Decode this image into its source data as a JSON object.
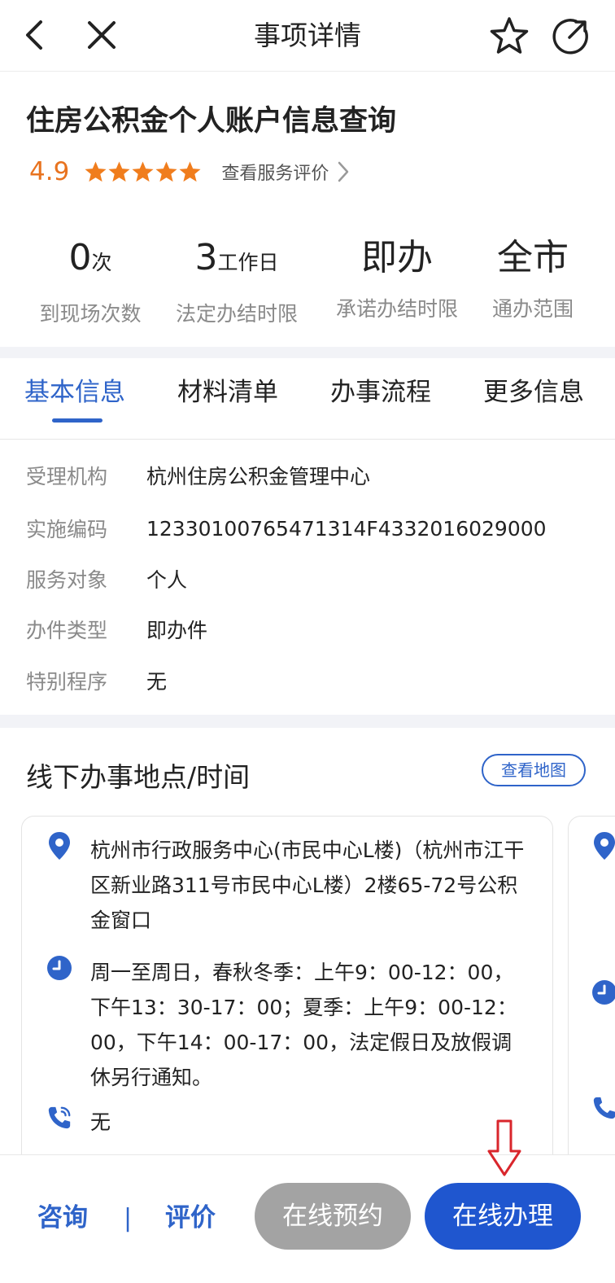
{
  "nav": {
    "title": "事项详情"
  },
  "item": {
    "title": "住房公积金个人账户信息查询",
    "rating": "4.9",
    "rating_stars": 5,
    "review_link": "查看服务评价"
  },
  "stats": [
    {
      "value": "0",
      "unit": "次",
      "label": "到现场次数"
    },
    {
      "value": "3",
      "unit": "工作日",
      "label": "法定办结时限"
    },
    {
      "value": "即办",
      "unit": "",
      "label": "承诺办结时限"
    },
    {
      "value": "全市",
      "unit": "",
      "label": "通办范围"
    }
  ],
  "tabs": [
    {
      "label": "基本信息",
      "active": true
    },
    {
      "label": "材料清单",
      "active": false
    },
    {
      "label": "办事流程",
      "active": false
    },
    {
      "label": "更多信息",
      "active": false
    }
  ],
  "info": [
    {
      "label": "受理机构",
      "value": "杭州住房公积金管理中心"
    },
    {
      "label": "实施编码",
      "value": "12330100765471314F4332016029000"
    },
    {
      "label": "服务对象",
      "value": "个人"
    },
    {
      "label": "办件类型",
      "value": "即办件"
    },
    {
      "label": "特别程序",
      "value": "无"
    }
  ],
  "offline": {
    "title": "线下办事地点/时间",
    "map_button": "查看地图",
    "card": {
      "address": "杭州市行政服务中心(市民中心L楼)（杭州市江干区新业路311号市民中心L楼）2楼65-72号公积金窗口",
      "hours": "周一至周日，春秋冬季：上午9：00-12：00，下午13：30-17：00；夏季：上午9：00-12：00，下午14：00-17：00，法定假日及放假调休另行通知。",
      "phone": "无"
    }
  },
  "bottom": {
    "consult": "咨询",
    "divider": "|",
    "evaluate": "评价",
    "reserve": "在线预约",
    "handle": "在线办理"
  },
  "colors": {
    "accent": "#2f64c9",
    "rating": "#e8731f",
    "star": "#f07d1d",
    "primary_button": "#1f56cf",
    "disabled_button": "#a3a3a3",
    "annotation": "#d9262c"
  }
}
